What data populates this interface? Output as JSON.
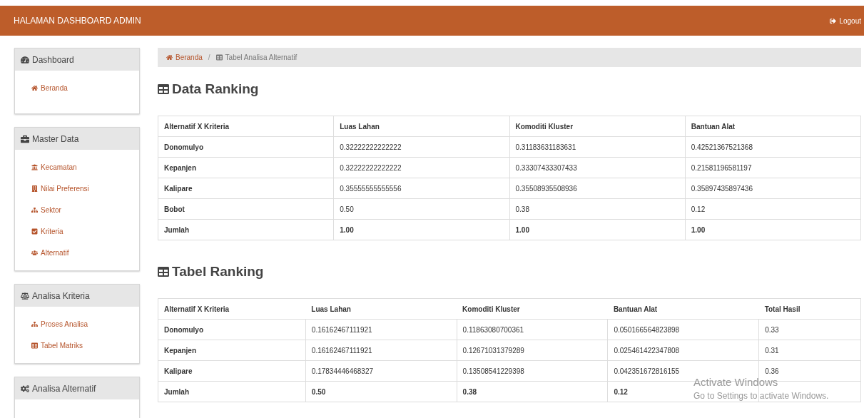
{
  "header": {
    "title": "HALAMAN DASHBOARD ADMIN",
    "logout": "Logout"
  },
  "sidebar": [
    {
      "title": "Dashboard",
      "items": [
        {
          "label": "Beranda"
        }
      ]
    },
    {
      "title": "Master Data",
      "items": [
        {
          "label": "Kecamatan"
        },
        {
          "label": "Nilai Preferensi"
        },
        {
          "label": "Sektor"
        },
        {
          "label": "Kriteria"
        },
        {
          "label": "Alternatif"
        }
      ]
    },
    {
      "title": "Analisa Kriteria",
      "items": [
        {
          "label": "Proses Analisa"
        },
        {
          "label": "Tabel Matriks"
        }
      ]
    },
    {
      "title": "Analisa Alternatif"
    }
  ],
  "breadcrumb": {
    "separator": "/",
    "items": [
      {
        "label": "Beranda",
        "kind": "link"
      },
      {
        "label": "Tabel Analisa Alternatif",
        "kind": "current"
      }
    ]
  },
  "sections": [
    {
      "title": "Data Ranking",
      "table": {
        "columns": [
          "Alternatif X Kriteria",
          "Luas Lahan",
          "Komoditi Kluster",
          "Bantuan Alat"
        ],
        "rows": [
          {
            "kind": "data",
            "cells": [
              "Donomulyo",
              "0.32222222222222",
              "0.31183631183631",
              "0.42521367521368"
            ]
          },
          {
            "kind": "data",
            "cells": [
              "Kepanjen",
              "0.32222222222222",
              "0.33307433307433",
              "0.21581196581197"
            ]
          },
          {
            "kind": "data",
            "cells": [
              "Kalipare",
              "0.35555555555556",
              "0.35508935508936",
              "0.35897435897436"
            ]
          },
          {
            "kind": "data",
            "cells": [
              "Bobot",
              "0.50",
              "0.38",
              "0.12"
            ]
          },
          {
            "kind": "total",
            "cells": [
              "Jumlah",
              "1.00",
              "1.00",
              "1.00"
            ]
          }
        ]
      }
    },
    {
      "title": "Tabel Ranking",
      "table": {
        "columns": [
          "Alternatif X Kriteria",
          "Luas Lahan",
          "Komoditi Kluster",
          "Bantuan Alat",
          "Total Hasil"
        ],
        "rows": [
          {
            "kind": "data",
            "cells": [
              "Donomulyo",
              "0.16162467111921",
              "0.11863080700361",
              "0.050166564823898",
              "0.33"
            ]
          },
          {
            "kind": "data",
            "cells": [
              "Kepanjen",
              "0.16162467111921",
              "0.12671031379289",
              "0.025461422347808",
              "0.31"
            ]
          },
          {
            "kind": "data",
            "cells": [
              "Kalipare",
              "0.17834446468327",
              "0.13508541229398",
              "0.042351672816155",
              "0.36"
            ]
          },
          {
            "kind": "total",
            "cells": [
              "Jumlah",
              "0.50",
              "0.38",
              "0.12"
            ]
          }
        ]
      }
    }
  ],
  "os_notice": {
    "title": "Activate Windows",
    "text": "Go to Settings to activate Windows."
  }
}
